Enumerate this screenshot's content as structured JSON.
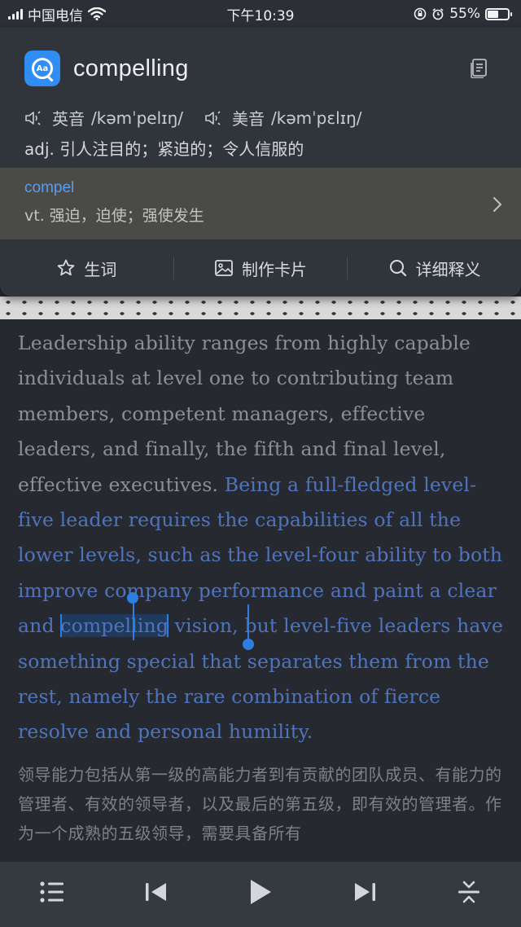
{
  "status_bar": {
    "carrier": "中国电信",
    "time": "下午10:39",
    "battery": "55%",
    "battery_level": 0.55
  },
  "dictionary": {
    "app_icon_text": "Aa",
    "word": "compelling",
    "pronunciations": [
      {
        "label": "英音",
        "ipa": "/kəmˈpelɪŋ/"
      },
      {
        "label": "美音",
        "ipa": "/kəmˈpɛlɪŋ/"
      }
    ],
    "definition": "adj. 引人注目的；紧迫的；令人信服的",
    "root": {
      "word": "compel",
      "definition": "vt. 强迫，迫使；强使发生"
    },
    "actions": [
      {
        "label": "生词",
        "icon": "star-icon"
      },
      {
        "label": "制作卡片",
        "icon": "image-icon"
      },
      {
        "label": "详细释义",
        "icon": "search-icon"
      }
    ]
  },
  "article": {
    "english_plain": "Leadership ability ranges from highly capable individuals at level one to contributing team members, competent managers, effective leaders, and finally, the fifth and final level, effective executives. ",
    "english_highlight_before": "Being a full-fledged level-five leader requires the capabilities of all the lower levels, such as the level-four ability to both improve company performance and paint a clear and ",
    "selected_word": "compelling",
    "english_highlight_after": " vision, but level-five leaders have something special that separates them from the rest, namely the rare combination of fierce resolve and personal humility.",
    "chinese": "领导能力包括从第一级的高能力者到有贡献的团队成员、有能力的管理者、有效的领导者，以及最后的第五级，即有效的管理者。作为一个成熟的五级领导，需要具备所有"
  },
  "player": {
    "buttons": [
      "list-icon",
      "previous-icon",
      "play-icon",
      "next-icon",
      "collapse-icon"
    ]
  }
}
